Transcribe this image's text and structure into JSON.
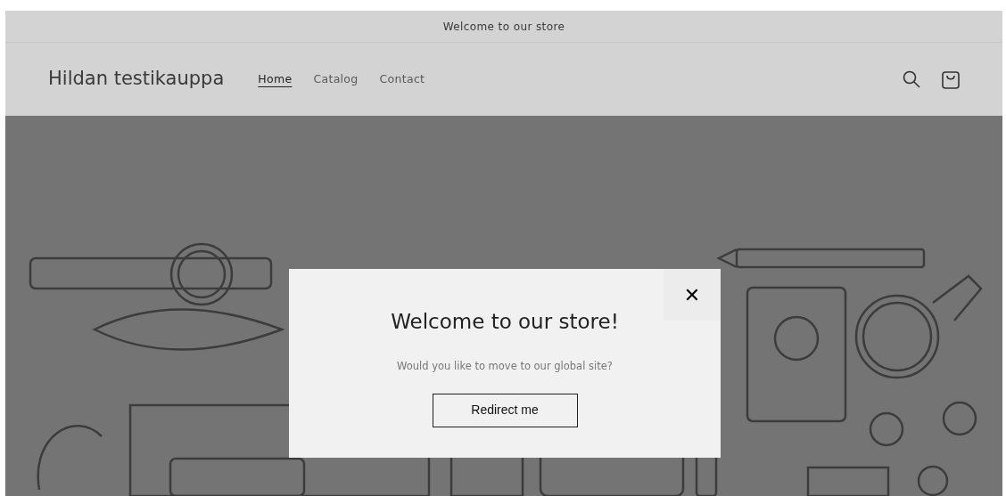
{
  "announcement": "Welcome to our store",
  "header": {
    "store_name": "Hildan testikauppa",
    "nav": [
      {
        "label": "Home",
        "selected": true
      },
      {
        "label": "Catalog",
        "selected": false
      },
      {
        "label": "Contact",
        "selected": false
      }
    ]
  },
  "modal": {
    "title": "Welcome to our store!",
    "message": "Would you like to move to our global site?",
    "button": "Redirect me",
    "close": "✕"
  }
}
